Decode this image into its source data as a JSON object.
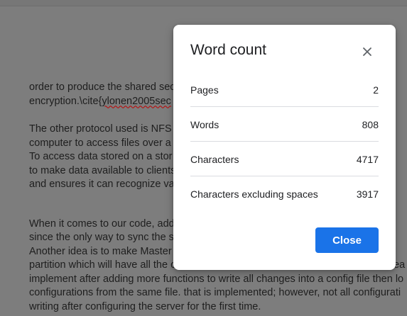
{
  "document": {
    "para1": [
      "order to produce the shared sec",
      "encryption.\\cite{",
      "ylonen2005sec"
    ],
    "para2": [
      "The other protocol used is NFS",
      "computer to access files over a",
      "To access data stored on a stor",
      "to make data available to clients",
      "and ensures it can recognize va"
    ],
    "para3": [
      "When it comes to our code, add",
      "since the only way to sync the s",
      "Another idea is to make Master",
      "partition which will have all the configurations for all clients, and servers. That is ea",
      "implement after adding more functions to write all changes into a config file then lo",
      "configurations from the same file. that is implemented; however, not all configurati",
      "writing after configuring the server for the first time."
    ]
  },
  "dialog": {
    "title": "Word count",
    "close_icon": "close-icon",
    "stats": [
      {
        "label": "Pages",
        "value": "2"
      },
      {
        "label": "Words",
        "value": "808"
      },
      {
        "label": "Characters",
        "value": "4717"
      },
      {
        "label": "Characters excluding spaces",
        "value": "3917"
      }
    ],
    "close_label": "Close"
  },
  "colors": {
    "accent": "#1a73e8",
    "overlay": "#7d7d7d"
  }
}
